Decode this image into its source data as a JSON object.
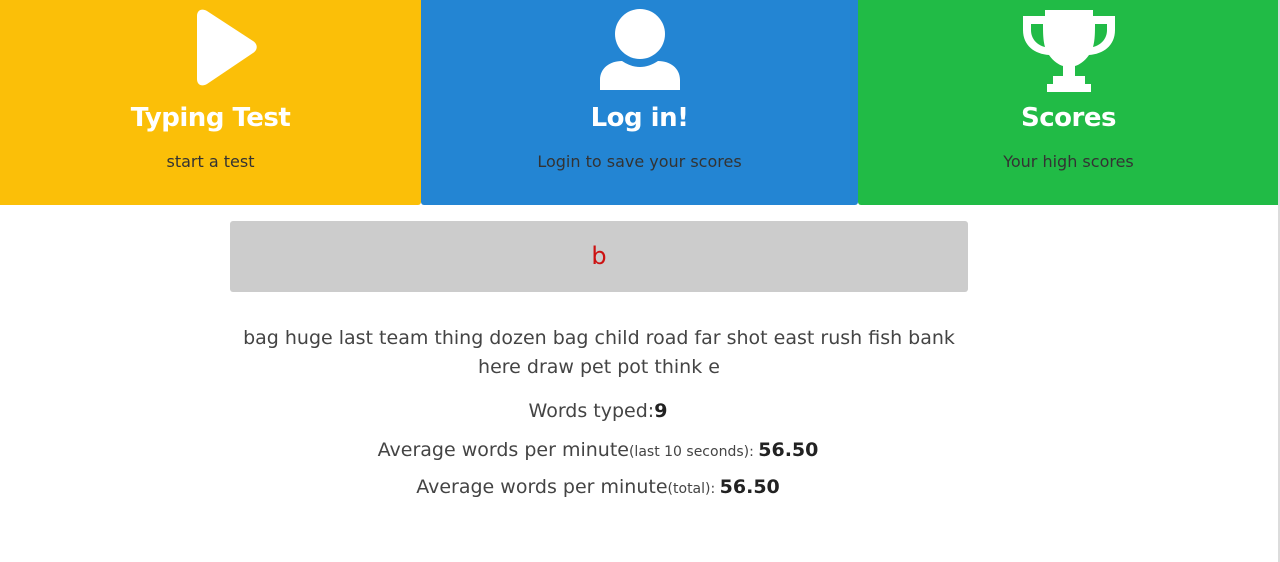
{
  "nav": {
    "typing_test": {
      "title": "Typing Test",
      "subtitle": "start a test",
      "icon": "play-icon",
      "color": "#fbbf08"
    },
    "login": {
      "title": "Log in!",
      "subtitle": "Login to save your scores",
      "icon": "user-icon",
      "color": "#2385d3"
    },
    "scores": {
      "title": "Scores",
      "subtitle": "Your high scores",
      "icon": "trophy-icon",
      "color": "#21bb46"
    }
  },
  "typing": {
    "current_input": "b",
    "input_color": "#cc1111"
  },
  "words": "bag huge last team thing dozen bag child road far shot east rush fish bank here draw pet pot think e",
  "stats": {
    "words_typed_label": "Words typed:",
    "words_typed": "9",
    "avg_label": "Average words per minute",
    "last10_note": "(last 10 seconds): ",
    "avg_last10": "56.50",
    "total_note": "(total): ",
    "avg_total": "56.50"
  }
}
